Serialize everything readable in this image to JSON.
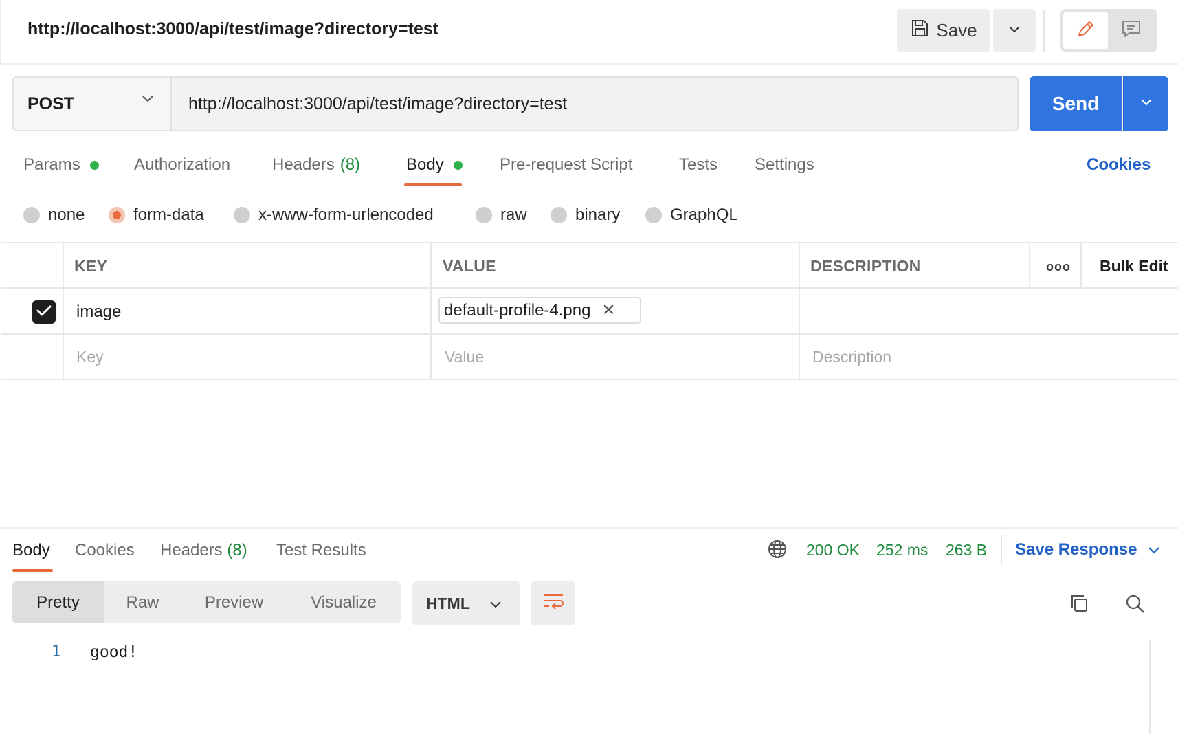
{
  "header": {
    "request_name": "http://localhost:3000/api/test/image?directory=test",
    "save_label": "Save"
  },
  "request": {
    "method": "POST",
    "url": "http://localhost:3000/api/test/image?directory=test",
    "send_label": "Send"
  },
  "request_tabs": {
    "params": "Params",
    "authorization": "Authorization",
    "headers": "Headers",
    "headers_count": "(8)",
    "body": "Body",
    "pre_request": "Pre-request Script",
    "tests": "Tests",
    "settings": "Settings",
    "cookies": "Cookies",
    "active": "Body"
  },
  "body_types": {
    "none": "none",
    "form_data": "form-data",
    "urlencoded": "x-www-form-urlencoded",
    "raw": "raw",
    "binary": "binary",
    "graphql": "GraphQL",
    "selected": "form-data"
  },
  "form_table": {
    "headers": {
      "key": "KEY",
      "value": "VALUE",
      "description": "DESCRIPTION"
    },
    "bulk_edit": "Bulk Edit",
    "more": "ooo",
    "rows": [
      {
        "checked": true,
        "key": "image",
        "value_file": "default-profile-4.png",
        "description": ""
      }
    ],
    "placeholders": {
      "key": "Key",
      "value": "Value",
      "description": "Description"
    }
  },
  "response": {
    "tabs": {
      "body": "Body",
      "cookies": "Cookies",
      "headers": "Headers",
      "headers_count": "(8)",
      "test_results": "Test Results",
      "active": "Body"
    },
    "status": "200 OK",
    "time": "252 ms",
    "size": "263 B",
    "save_response": "Save Response",
    "view_modes": [
      "Pretty",
      "Raw",
      "Preview",
      "Visualize"
    ],
    "active_view": "Pretty",
    "language": "HTML",
    "lines": [
      {
        "number": "1",
        "text": "good!"
      }
    ]
  },
  "colors": {
    "accent_orange": "#e86a3d",
    "send_blue": "#2f74e0",
    "link_blue": "#2262c6",
    "status_green": "#1f8a3d",
    "dot_green": "#2fb24c"
  }
}
